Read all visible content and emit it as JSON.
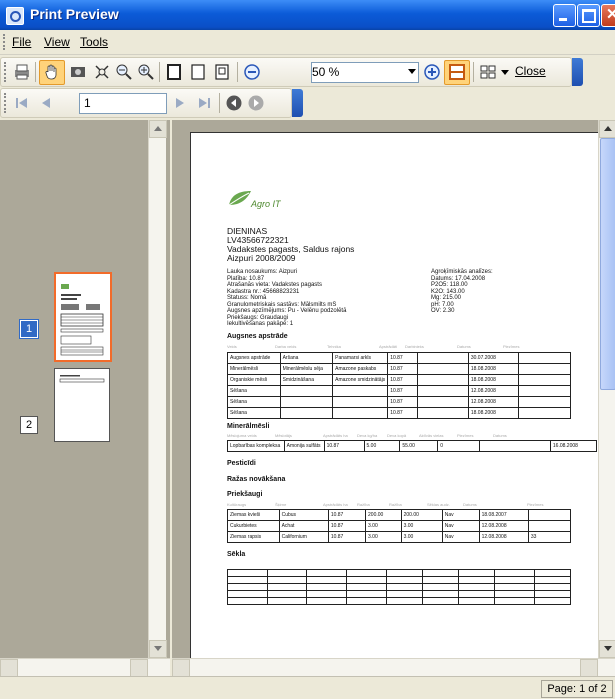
{
  "window": {
    "title": "Print Preview"
  },
  "menu": [
    {
      "label": "File"
    },
    {
      "label": "View"
    },
    {
      "label": "Tools"
    }
  ],
  "toolbar": {
    "zoom": "50 %",
    "close_label": "Close"
  },
  "nav": {
    "page": "1"
  },
  "thumbs": [
    {
      "num": "1"
    },
    {
      "num": "2"
    }
  ],
  "status": {
    "page": "Page: 1 of 2"
  },
  "doc": {
    "logo": "Agro IT",
    "name": "DIENINAS",
    "code": "LV43566722321",
    "loc1": "Vadakstes pagasts, Saldus rajons",
    "loc2": "Aizpuri 2008/2009",
    "left_info": [
      "Lauka nosaukums: Aizpuri",
      "Platība: 10.87",
      "Atrašanās vieta: Vadakstes pagasts",
      "Kadastra nr.: 45668823231",
      "Statuss: Nomā",
      "Granulometriskais sastāvs: Mālsmilts mS",
      "Augsnes apzīmējums: Pu - Velēnu podzolētā",
      "Priekšaugs: Graudaugi",
      "Iekultivēšanas pakāpe: 1"
    ],
    "right_info": [
      "Agroķīmiskās analīzes:",
      "Datums: 17.04.2008",
      "P2O5: 118.00",
      "K2O: 143.00",
      "Mg: 215.00",
      "pH: 7.00",
      "OV: 2.30"
    ],
    "s1": "Augsnes apstrāde",
    "s1_hdr": [
      "Veids",
      "Darba veids",
      "Tehnika",
      "Apstrādāti",
      "Darbinieks",
      "Datums",
      "Piezīmes"
    ],
    "s1_rows": [
      [
        "Augsnes apstrāde",
        "Aršana",
        "Panamarsi arkls",
        "10.87",
        "",
        "30.07.2008",
        ""
      ],
      [
        "Minerālmēsli",
        "Minerālmēslu sēja",
        "Amazone paskabs",
        "10.87",
        "",
        "18.08.2008",
        ""
      ],
      [
        "Organiskie mēsli",
        "Smidzināšana",
        "Amazone smidzinātājs",
        "10.87",
        "",
        "18.08.2008",
        ""
      ],
      [
        "Sēšana",
        "",
        "",
        "10.87",
        "",
        "12.08.2008",
        ""
      ],
      [
        "Sēšana",
        "",
        "",
        "10.87",
        "",
        "12.08.2008",
        ""
      ],
      [
        "Sēšana",
        "",
        "",
        "10.87",
        "",
        "18.08.2008",
        ""
      ]
    ],
    "s2": "Minerālmēsli",
    "s2_hdr": [
      "Mēslojuma veids",
      "Mēslotājs",
      "Apstrādāts ha",
      "Deva kg/ha",
      "Deva kopā",
      "Aktīvās vielas",
      "Piezīmes",
      "Datums"
    ],
    "s2_rows": [
      [
        "Lopbarības kompleksa",
        "Amonija sulfāts",
        "10.87",
        "5.00",
        "55.00",
        "0",
        "",
        "16.08.2008"
      ]
    ],
    "s3": "Pesticīdi",
    "s4": "Ražas novākšana",
    "s5": "Priekšaugi",
    "s5_hdr": [
      "Kultūraugs",
      "Šķirne",
      "Apstrādāts ha",
      "Ražība",
      "Ražība",
      "Sēklas audz.",
      "Datums",
      "Piezīmes"
    ],
    "s5_rows": [
      [
        "Ziemas kvieši",
        "Cubus",
        "10.87",
        "200.00",
        "200.00",
        "Nav",
        "18.08.2007",
        ""
      ],
      [
        "Cukurbietes",
        "Achat",
        "10.87",
        "3.00",
        "3.00",
        "Nav",
        "12.08.2008",
        ""
      ],
      [
        "Ziemas rapsis",
        "Californium",
        "10.87",
        "3.00",
        "3.00",
        "Nav",
        "12.08.2008",
        "33"
      ]
    ],
    "s6": "Sēkla",
    "s6_rows": [
      [
        "",
        "",
        "",
        "",
        "",
        "",
        "",
        "",
        ""
      ],
      [
        "",
        "",
        "",
        "",
        "",
        "",
        "",
        "",
        ""
      ],
      [
        "",
        "",
        "",
        "",
        "",
        "",
        "",
        "",
        ""
      ],
      [
        "",
        "",
        "",
        "",
        "",
        "",
        "",
        "",
        ""
      ],
      [
        "",
        "",
        "",
        "",
        "",
        "",
        "",
        "",
        ""
      ]
    ]
  },
  "colors": {
    "accent": "#316ac5",
    "thumb_highlight": "#f26b2a",
    "logo_green": "#5a9e3a"
  }
}
